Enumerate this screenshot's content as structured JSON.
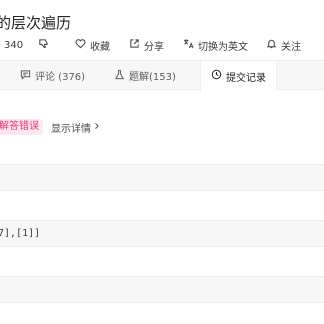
{
  "problem": {
    "title": "的层次遍历"
  },
  "actions": {
    "dislike_count": "340",
    "favorite_label": "收藏",
    "share_label": "分享",
    "switch_lang_label": "切换为英文",
    "follow_label": "关注"
  },
  "tabs": [
    {
      "label": "评论 (376)"
    },
    {
      "label": "题解(153)"
    },
    {
      "label": "提交记录"
    }
  ],
  "result": {
    "status": "解答错误",
    "detail_link": "显示详情"
  },
  "rows": {
    "output_snippet": "7],[1]]"
  },
  "colors": {
    "error_badge_bg": "#fde8ef",
    "error_badge_text": "#e3346c",
    "panel_gray": "#f7f7f8"
  }
}
